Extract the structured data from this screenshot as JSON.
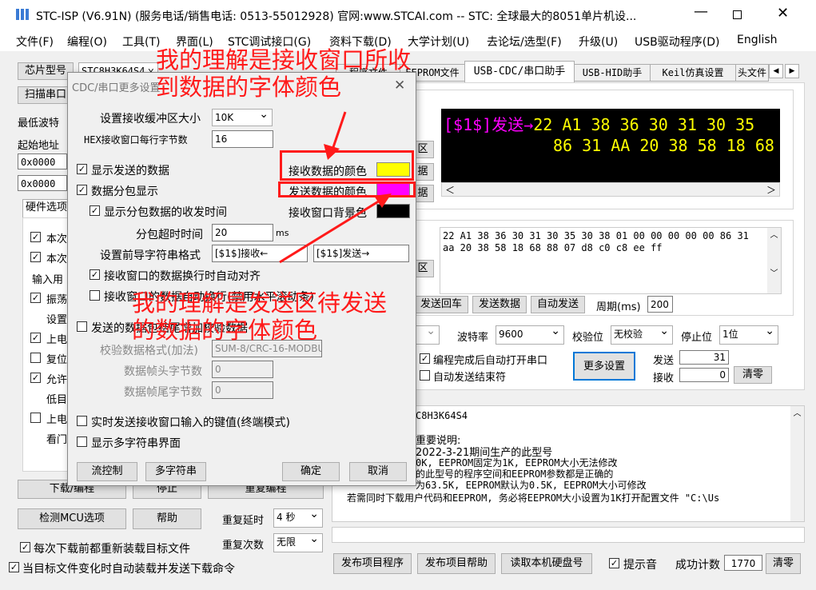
{
  "window": {
    "title": "STC-ISP (V6.91N) (服务电话/销售电话: 0513-55012928) 官网:www.STCAI.com  -- STC: 全球最大的8051单片机设..."
  },
  "menu": [
    "文件(F)",
    "编程(O)",
    "工具(T)",
    "界面(L)",
    "STC调试接口(G)",
    "资料下载(D)",
    "大学计划(U)",
    "去论坛/选型(F)",
    "升级(U)",
    "USB驱动程序(D)",
    "English"
  ],
  "left": {
    "chip_label": "芯片型号",
    "chip_value": "STC8H3K64S4",
    "scan_label": "扫描串口",
    "baud_label": "最低波特",
    "start_label": "起始地址",
    "addr1": "0x0000",
    "addr2": "0x0000",
    "hw_tab": "硬件选项",
    "lines": [
      "本次",
      "本次",
      "输入用",
      "振荡",
      "设置",
      "上电",
      "复位",
      "允许",
      "低目",
      "上电",
      "看门"
    ],
    "download_btn": "下载/编程",
    "stop_btn": "停止",
    "reprog_btn": "重复编程",
    "detect_btn": "检测MCU选项",
    "help_btn": "帮助",
    "delay_label": "重复延时",
    "delay_value": "4 秒",
    "count_label": "重复次数",
    "count_value": "无限",
    "reload_chk": "每次下载前都重新装载目标文件",
    "auto_chk": "当目标文件变化时自动装载并发送下载命令"
  },
  "tabs": [
    "程序文件",
    "EEPROM文件",
    "USB-CDC/串口助手",
    "USB-HID助手",
    "Keil仿真设置",
    "头文件"
  ],
  "right": {
    "recv_line1": "[$1$]发送→22 A1 38 36 30 31 30 35",
    "recv_line2": "86 31 AA 20 38 58 18 68",
    "send_line1": "22 A1 38 36 30 31 30 35 30 38 01 00 00 00 00 00 86 31",
    "send_line2": "aa 20 38 58 18 68 88 07 d8 c0 c8 ee ff",
    "side_btns": [
      "区",
      "据",
      "据",
      "区"
    ],
    "send_enter": "发送回车",
    "send_data": "发送数据",
    "auto_send": "自动发送",
    "period_label": "周期(ms)",
    "period_value": "200",
    "baud_label": "波特率",
    "baud_value": "9600",
    "parity_label": "校验位",
    "parity_value": "无校验",
    "stop_label": "停止位",
    "stop_value": "1位",
    "auto_open": "编程完成后自动打开串口",
    "auto_end": "自动发送结束符",
    "more_btn": "更多设置",
    "sent_label": "发送",
    "sent_value": "31",
    "recv_label": "接收",
    "recv_value": "0",
    "clear_btn": "清零"
  },
  "info": {
    "chip": "C8H3K64S4",
    "lines": [
      "重要说明:",
      "2022-3-21期间生产的此型号",
      "0K, EEPROM固定为1K, EEPROM大小无法修改",
      "的此型号的程序空间和EEPROM参数都是正确的",
      "为63.5K, EEPROM默认为0.5K, EEPROM大小可修改",
      "若需同时下载用户代码和EEPROM, 务必将EEPROM大小设置为1K打开配置文件 \"C:\\Us"
    ]
  },
  "bottom": {
    "publish_prog": "发布项目程序",
    "publish_help": "发布项目帮助",
    "read_disk": "读取本机硬盘号",
    "sound_chk": "提示音",
    "success_label": "成功计数",
    "success_value": "1770",
    "clear_btn": "清零"
  },
  "dialog": {
    "title": "CDC/串口更多设置",
    "buf_label": "设置接收缓冲区大小",
    "buf_value": "10K",
    "hex_label": "HEX接收窗口每行字节数",
    "hex_value": "16",
    "show_sent": "显示发送的数据",
    "packet_show": "数据分包显示",
    "show_time": "显示分包数据的收发时间",
    "timeout_label": "分包超时时间",
    "timeout_value": "20",
    "timeout_unit": "ms",
    "prefix_label": "设置前导字符串格式",
    "prefix_recv": "[$1$]接收←",
    "prefix_send": "[$1$]发送→",
    "auto_align": "接收窗口的数据换行时自动对齐",
    "auto_scroll": "接收窗口的数据自动换行(禁用水平滚动条)",
    "recv_color_label": "接收数据的颜色",
    "send_color_label": "发送数据的颜色",
    "bg_color_label": "接收窗口背景色",
    "recv_color": "#ffff00",
    "send_color": "#ff00ff",
    "bg_color": "#000000",
    "checksum": "发送的数据包结尾增加校验数据",
    "checksum_mode": "校验数据格式(加法)",
    "checksum_mode2": "SUM-8/CRC-16-MODBUS",
    "head_label": "数据帧头字节数",
    "head_value": "0",
    "tail_label": "数据帧尾字节数",
    "tail_value": "0",
    "realtime": "实时发送接收窗口输入的键值(终端模式)",
    "multi": "显示多字符串界面",
    "flow_btn": "流控制",
    "multi_btn": "多字符串",
    "ok_btn": "确定",
    "cancel_btn": "取消"
  },
  "annotations": {
    "top": "我的理解是接收窗口所收到数据的字体颜色",
    "bottom": "我的理解是发送区待发送的数据的字体颜色"
  }
}
